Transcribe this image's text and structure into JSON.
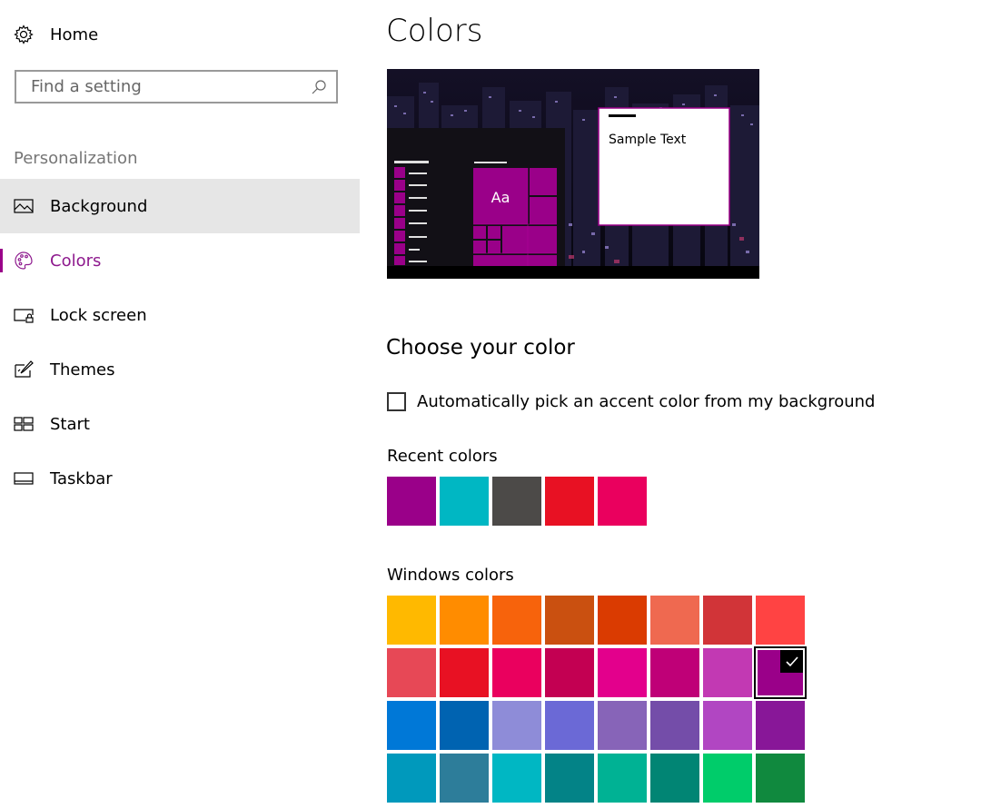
{
  "sidebar": {
    "home_label": "Home",
    "search": {
      "placeholder": "Find a setting",
      "value": ""
    },
    "section_title": "Personalization",
    "items": [
      {
        "label": "Background",
        "icon": "picture-icon"
      },
      {
        "label": "Colors",
        "icon": "palette-icon"
      },
      {
        "label": "Lock screen",
        "icon": "lock-screen-icon"
      },
      {
        "label": "Themes",
        "icon": "themes-icon"
      },
      {
        "label": "Start",
        "icon": "start-icon"
      },
      {
        "label": "Taskbar",
        "icon": "taskbar-icon"
      }
    ]
  },
  "main": {
    "title": "Colors",
    "preview": {
      "tile_text": "Aa",
      "sample_text": "Sample Text"
    },
    "choose_title": "Choose your color",
    "auto_pick": {
      "label": "Automatically pick an accent color from my background",
      "checked": false
    },
    "recent_label": "Recent colors",
    "recent_colors": [
      "#9a0089",
      "#00b7c3",
      "#4c4a48",
      "#e81123",
      "#ea005e"
    ],
    "windows_label": "Windows colors",
    "windows_colors": [
      [
        "#ffb900",
        "#ff8c00",
        "#f7630c",
        "#ca5010",
        "#da3b01",
        "#ef6950",
        "#d13438",
        "#ff4343"
      ],
      [
        "#e74856",
        "#e81123",
        "#ea005e",
        "#c30052",
        "#e3008c",
        "#bf0077",
        "#c239b3",
        "#9a0089"
      ],
      [
        "#0078d7",
        "#0063b1",
        "#8e8cd8",
        "#6b69d6",
        "#8764b8",
        "#744da9",
        "#b146c2",
        "#881798"
      ],
      [
        "#0099bc",
        "#2d7d9a",
        "#00b7c3",
        "#038387",
        "#00b294",
        "#018574",
        "#00cc6a",
        "#10893e"
      ]
    ],
    "selected_color": "#9a0089",
    "accent_color": "#9a0089"
  }
}
